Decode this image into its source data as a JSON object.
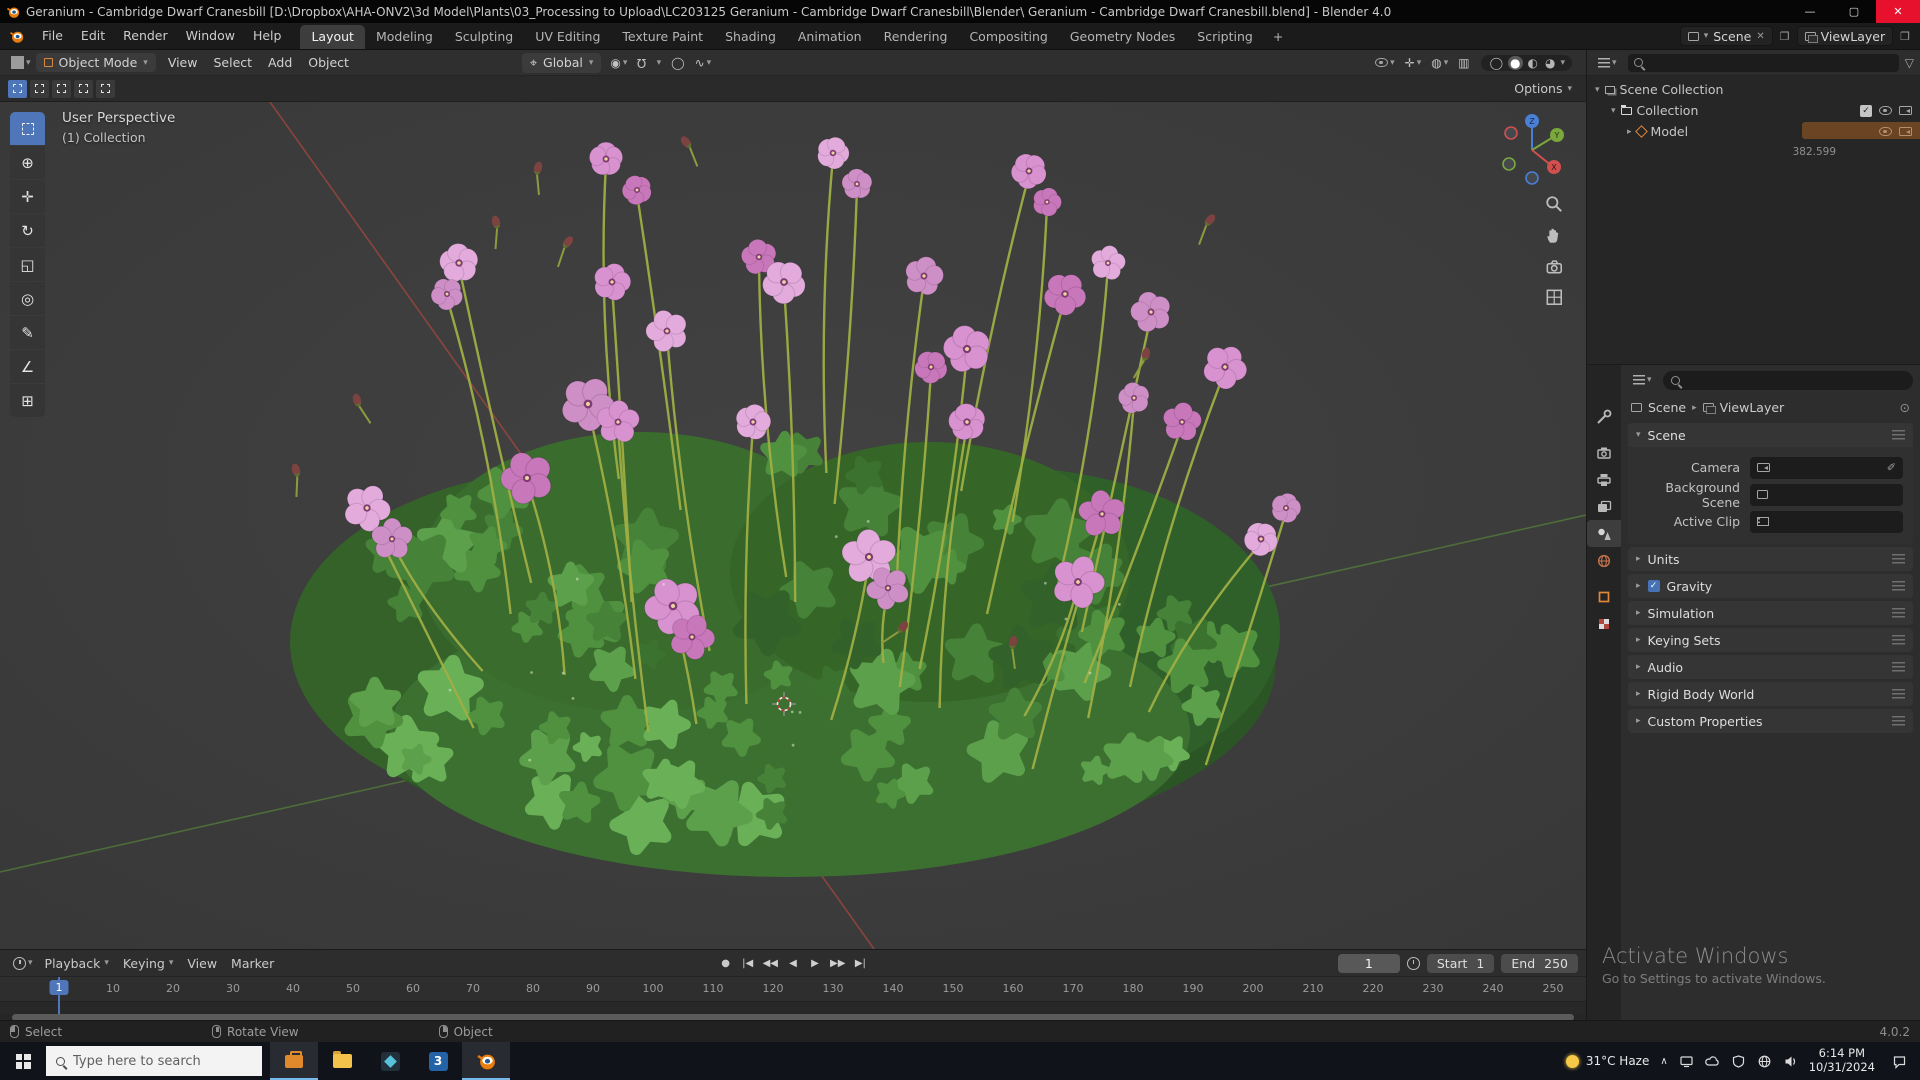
{
  "titlebar": {
    "title": "Geranium - Cambridge Dwarf Cranesbill [D:\\Dropbox\\AHA-ONV2\\3d Model\\Plants\\03_Processing to Upload\\LC203125 Geranium - Cambridge Dwarf Cranesbill\\Blender\\ Geranium - Cambridge Dwarf Cranesbill.blend] - Blender 4.0"
  },
  "icons": {
    "minimize": "—",
    "maximize": "▢",
    "close": "✕",
    "chevron_down": "▾",
    "chevron_right": "▸",
    "chevron_up": "∧",
    "check": "✓",
    "close_small": "✕",
    "copy": "❐",
    "filter": "▽",
    "pin": "⊙",
    "tool_cursor": "⊕",
    "tool_move": "✛",
    "tool_rotate": "↻",
    "tool_scale": "◱",
    "tool_transform": "◎",
    "tool_annotate": "✎",
    "tool_measure": "∠",
    "tool_cube": "⊞",
    "orientation": "⌖",
    "pivot": "◉",
    "magnet": "Ω",
    "prop_edit": "◯",
    "falloff": "∿",
    "overlay": "◍",
    "xray": "▥",
    "shade_wire": "◯",
    "shade_solid": "●",
    "shade_material": "◐",
    "shade_rendered": "◕",
    "record": "●",
    "jump_start": "|◀",
    "prev_key": "◀◀",
    "play_rev": "◀",
    "play": "▶",
    "next_key": "▶▶",
    "jump_end": "▶|",
    "eyedropper": "✐"
  },
  "topbar": {
    "menus": [
      "File",
      "Edit",
      "Render",
      "Window",
      "Help"
    ],
    "workspaces": [
      "Layout",
      "Modeling",
      "Sculpting",
      "UV Editing",
      "Texture Paint",
      "Shading",
      "Animation",
      "Rendering",
      "Compositing",
      "Geometry Nodes",
      "Scripting"
    ],
    "add_workspace": "+",
    "scene": "Scene",
    "viewlayer": "ViewLayer"
  },
  "viewport_header": {
    "mode": "Object Mode",
    "menus": [
      "View",
      "Select",
      "Add",
      "Object"
    ],
    "orientation": "Global",
    "options": "Options"
  },
  "viewport": {
    "perspective": "User Perspective",
    "collection": "(1) Collection"
  },
  "outliner": {
    "rows": [
      {
        "label": "Scene Collection"
      },
      {
        "label": "Collection"
      },
      {
        "label": "Model"
      }
    ],
    "stat": "382.599"
  },
  "properties": {
    "breadcrumb": {
      "scene": "Scene",
      "viewlayer": "ViewLayer"
    },
    "scene_panel": {
      "title": "Scene",
      "camera_label": "Camera",
      "background_label": "Background Scene",
      "clip_label": "Active Clip"
    },
    "panels": [
      "Units",
      "Gravity",
      "Simulation",
      "Keying Sets",
      "Audio",
      "Rigid Body World",
      "Custom Properties"
    ]
  },
  "timeline": {
    "menus": [
      "Playback",
      "Keying",
      "View",
      "Marker"
    ],
    "current_frame": "1",
    "start_label": "Start",
    "start_value": "1",
    "end_label": "End",
    "end_value": "250",
    "ticks": [
      "1",
      "10",
      "20",
      "30",
      "40",
      "50",
      "60",
      "70",
      "80",
      "90",
      "100",
      "110",
      "120",
      "130",
      "140",
      "150",
      "160",
      "170",
      "180",
      "190",
      "200",
      "210",
      "220",
      "230",
      "240",
      "250"
    ]
  },
  "statusbar": {
    "select": "Select",
    "rotate": "Rotate View",
    "object": "Object",
    "version": "4.0.2"
  },
  "watermark": {
    "line1": "Activate Windows",
    "line2": "Go to Settings to activate Windows."
  },
  "taskbar": {
    "search_placeholder": "Type here to search",
    "app3_label": "3",
    "weather": "31°C Haze",
    "time": "6:14 PM",
    "date": "10/31/2024"
  }
}
